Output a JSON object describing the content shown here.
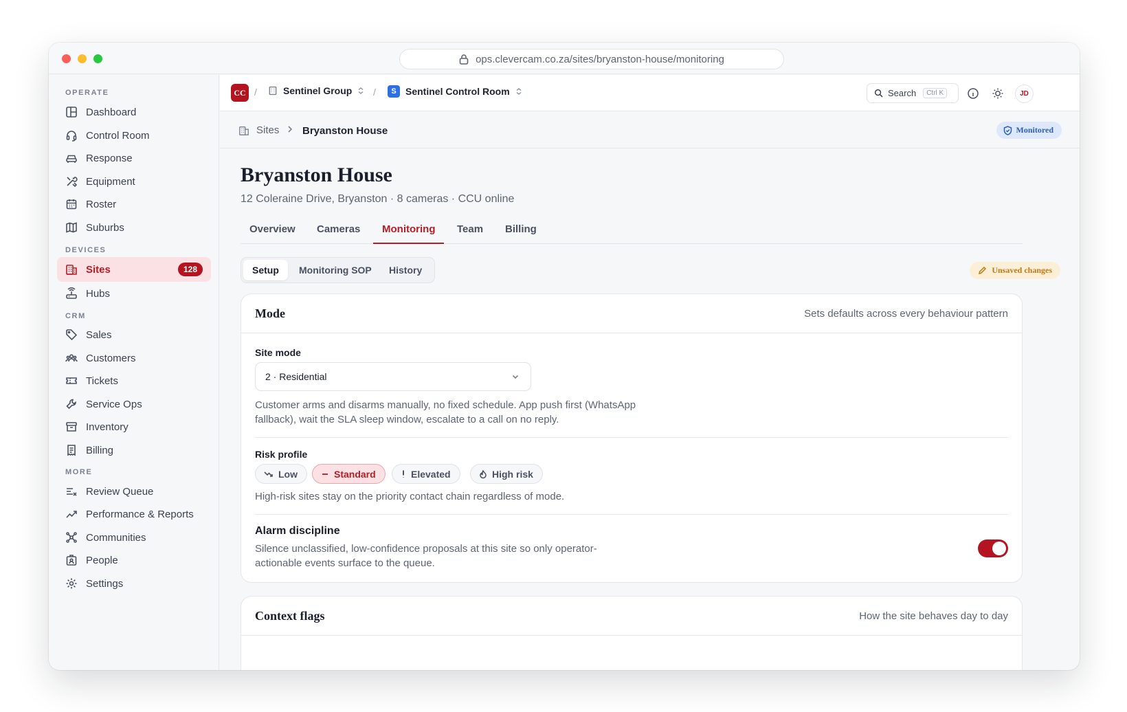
{
  "browser": {
    "url": "ops.clevercam.co.za/sites/bryanston-house/monitoring"
  },
  "sidebar": {
    "sections": [
      {
        "label": "OPERATE"
      },
      {
        "label": "DEVICES"
      },
      {
        "label": "CRM"
      },
      {
        "label": "MORE"
      }
    ],
    "items": [
      {
        "label": "Dashboard",
        "icon": "layout-icon"
      },
      {
        "label": "Control Room",
        "icon": "headset-icon"
      },
      {
        "label": "Response",
        "icon": "car-icon"
      },
      {
        "label": "Equipment",
        "icon": "tools-icon"
      },
      {
        "label": "Roster",
        "icon": "calendar-icon"
      },
      {
        "label": "Suburbs",
        "icon": "map-icon"
      },
      {
        "label": "Sites",
        "icon": "building-icon",
        "badge": "128",
        "active": true
      },
      {
        "label": "Hubs",
        "icon": "router-icon"
      },
      {
        "label": "Sales",
        "icon": "tag-icon"
      },
      {
        "label": "Customers",
        "icon": "users-icon"
      },
      {
        "label": "Tickets",
        "icon": "ticket-icon"
      },
      {
        "label": "Service Ops",
        "icon": "wrench-icon"
      },
      {
        "label": "Inventory",
        "icon": "archive-icon"
      },
      {
        "label": "Billing",
        "icon": "receipt-icon"
      },
      {
        "label": "Review Queue",
        "icon": "list-check-icon"
      },
      {
        "label": "Performance & Reports",
        "icon": "trend-icon"
      },
      {
        "label": "Communities",
        "icon": "network-icon"
      },
      {
        "label": "People",
        "icon": "id-badge-icon"
      },
      {
        "label": "Settings",
        "icon": "gear-icon"
      }
    ]
  },
  "topbar": {
    "org_logo": "CC",
    "org_name": "Sentinel Group",
    "workspace_logo": "S",
    "workspace_name": "Sentinel Control Room",
    "search_label": "Search",
    "search_shortcut": "Ctrl K",
    "avatar_initials": "JD"
  },
  "breadcrumb": {
    "parent": "Sites",
    "current": "Bryanston House",
    "status_badge": "Monitored"
  },
  "page": {
    "title": "Bryanston House",
    "subtitle": "12 Coleraine Drive, Bryanston · 8 cameras · CCU online",
    "tabs": [
      {
        "label": "Overview"
      },
      {
        "label": "Cameras"
      },
      {
        "label": "Monitoring",
        "active": true
      },
      {
        "label": "Team"
      },
      {
        "label": "Billing"
      }
    ],
    "subtabs": [
      {
        "label": "Setup",
        "active": true
      },
      {
        "label": "Monitoring SOP"
      },
      {
        "label": "History"
      }
    ],
    "unsaved_label": "Unsaved changes"
  },
  "mode_card": {
    "title": "Mode",
    "hint": "Sets defaults across every behaviour pattern",
    "site_mode_label": "Site mode",
    "site_mode_value": "2 · Residential",
    "site_mode_help_line1": "Customer arms and disarms manually, no fixed schedule. App push first (WhatsApp",
    "site_mode_help_line2": "fallback), wait the SLA sleep window, escalate to a call on no reply.",
    "risk_label": "Risk profile",
    "risk_options": [
      {
        "label": "Low",
        "icon": "trend-down-icon"
      },
      {
        "label": "Standard",
        "icon": "minus-icon",
        "selected": true
      },
      {
        "label": "Elevated",
        "icon": "exclamation-icon"
      },
      {
        "label": "High risk",
        "icon": "flame-icon"
      }
    ],
    "risk_help": "High-risk sites stay on the priority contact chain regardless of mode.",
    "alarm_title": "Alarm discipline",
    "alarm_help_line1": "Silence unclassified, low-confidence proposals at this site so only operator-",
    "alarm_help_line2": "actionable events surface to the queue.",
    "alarm_enabled": true
  },
  "context_card": {
    "title": "Context flags",
    "hint": "How the site behaves day to day"
  },
  "colors": {
    "accent": "#b4141f",
    "accent_soft": "#fbe1e3",
    "info_soft": "#dde9fb",
    "warning_soft": "#fbefd7"
  }
}
